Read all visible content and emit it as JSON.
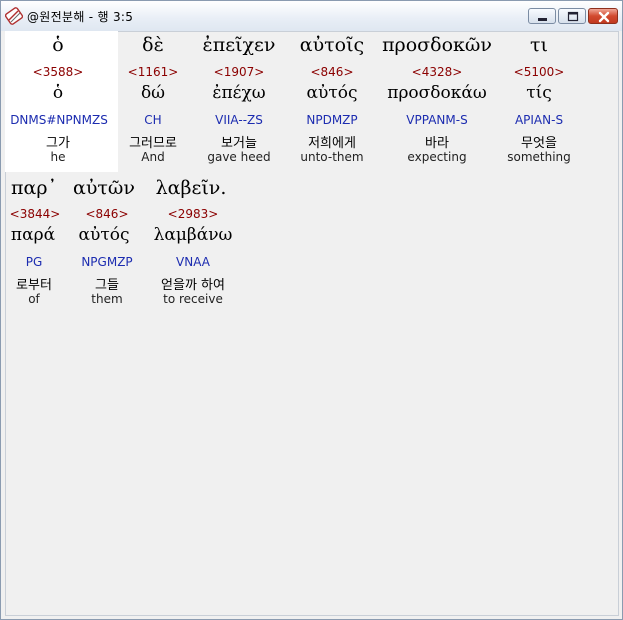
{
  "window": {
    "title": "@원전분해 - 행 3:5",
    "icon": "app-scroll-icon"
  },
  "controls": {
    "minimize": "minimize-icon",
    "maximize": "maximize-icon",
    "close": "close-icon"
  },
  "rows": [
    {
      "tokens": [
        {
          "greek": "ὁ",
          "strong": "<3588>",
          "lemma": "ὁ",
          "parse": "DNMS#NPNMZS",
          "korean": "그가",
          "english": "he",
          "selected": true
        },
        {
          "greek": "δὲ",
          "strong": "<1161>",
          "lemma": "δώ",
          "parse": "CH",
          "korean": "그러므로",
          "english": "And"
        },
        {
          "greek": "ἐπεῖχεν",
          "strong": "<1907>",
          "lemma": "ἐπέχω",
          "parse": "VIIA--ZS",
          "korean": "보거늘",
          "english": "gave heed"
        },
        {
          "greek": "αὐτοῖς",
          "strong": "<846>",
          "lemma": "αὐτός",
          "parse": "NPDMZP",
          "korean": "저희에게",
          "english": "unto-them"
        },
        {
          "greek": "προσδοκῶν",
          "strong": "<4328>",
          "lemma": "προσδοκάω",
          "parse": "VPPANM-S",
          "korean": "바라",
          "english": "expecting"
        },
        {
          "greek": "τι",
          "strong": "<5100>",
          "lemma": "τίς",
          "parse": "APIAN-S",
          "korean": "무엇을",
          "english": "something"
        }
      ]
    },
    {
      "tokens": [
        {
          "greek": "παρ᾽",
          "strong": "<3844>",
          "lemma": "παρά",
          "parse": "PG",
          "korean": "로부터",
          "english": "of"
        },
        {
          "greek": "αὐτῶν",
          "strong": "<846>",
          "lemma": "αὐτός",
          "parse": "NPGMZP",
          "korean": "그들",
          "english": "them"
        },
        {
          "greek": "λαβεῖν.",
          "strong": "<2983>",
          "lemma": "λαμβάνω",
          "parse": "VNAA",
          "korean": "얻을까 하여",
          "english": "to receive"
        }
      ]
    }
  ]
}
